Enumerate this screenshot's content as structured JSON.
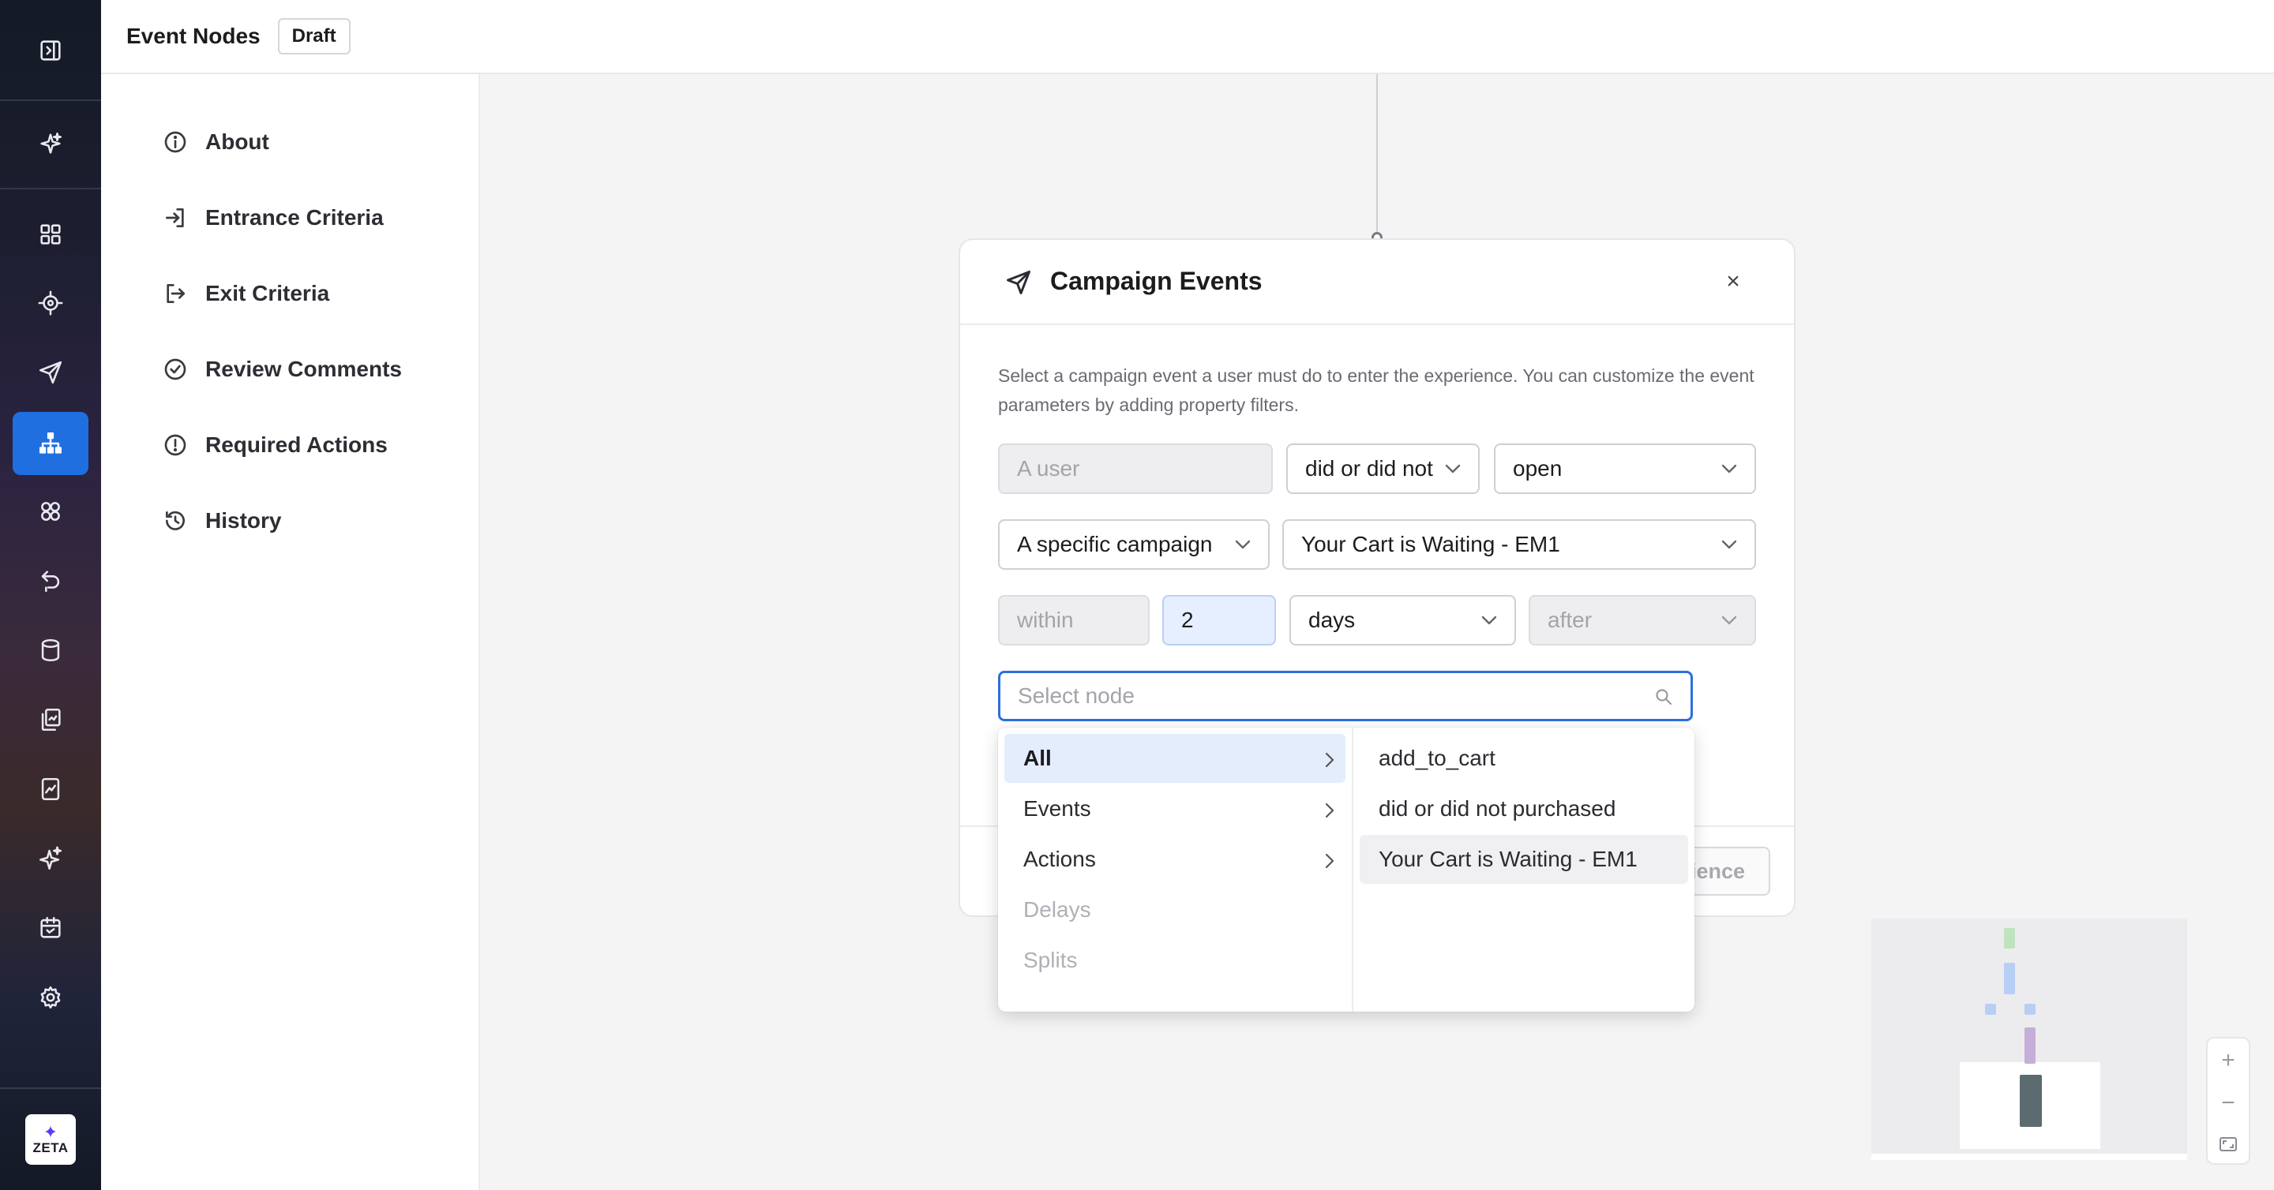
{
  "topbar": {
    "title": "Event Nodes",
    "status_badge": "Draft"
  },
  "sidemenu": {
    "items": [
      {
        "label": "About",
        "icon": "info-icon"
      },
      {
        "label": "Entrance Criteria",
        "icon": "enter-icon"
      },
      {
        "label": "Exit Criteria",
        "icon": "exit-icon"
      },
      {
        "label": "Review Comments",
        "icon": "check-circle-icon"
      },
      {
        "label": "Required Actions",
        "icon": "alert-circle-icon"
      },
      {
        "label": "History",
        "icon": "history-icon"
      }
    ]
  },
  "rail": {
    "icons": [
      "collapse-sidebar-icon",
      "sparkle-icon",
      "dashboard-grid-icon",
      "target-icon",
      "send-icon",
      "journey-tree-icon",
      "segments-icon",
      "return-icon",
      "database-icon",
      "content-copy-icon",
      "reports-icon",
      "ai-sparkle-icon",
      "calendar-icon",
      "settings-gear-icon"
    ],
    "active": "journey-tree-icon",
    "logo_text": "ZETA"
  },
  "modal": {
    "title": "Campaign Events",
    "description": "Select a campaign event a user must do to enter the experience. You can customize the event parameters by adding property filters.",
    "row1": {
      "subject": "A user",
      "condition": "did or did not",
      "event": "open"
    },
    "row2": {
      "scope": "A specific campaign",
      "campaign": "Your Cart is Waiting - EM1"
    },
    "row3": {
      "qualifier": "within",
      "amount": "2",
      "unit": "days",
      "relation": "after"
    },
    "search": {
      "placeholder": "Select node",
      "value": ""
    },
    "categories": [
      {
        "label": "All",
        "state": "active",
        "has_children": true
      },
      {
        "label": "Events",
        "state": "enabled",
        "has_children": true
      },
      {
        "label": "Actions",
        "state": "enabled",
        "has_children": true
      },
      {
        "label": "Delays",
        "state": "disabled",
        "has_children": false
      },
      {
        "label": "Splits",
        "state": "disabled",
        "has_children": false
      }
    ],
    "options": [
      {
        "label": "add_to_cart"
      },
      {
        "label": "did or did not purchased"
      },
      {
        "label": "Your Cart is Waiting - EM1",
        "state": "hovered"
      }
    ],
    "footer_button_partial": "ience"
  },
  "colors": {
    "accent": "#1f6fe0",
    "selected_bg": "#e4edfc",
    "number_field_bg": "#e6efff"
  }
}
